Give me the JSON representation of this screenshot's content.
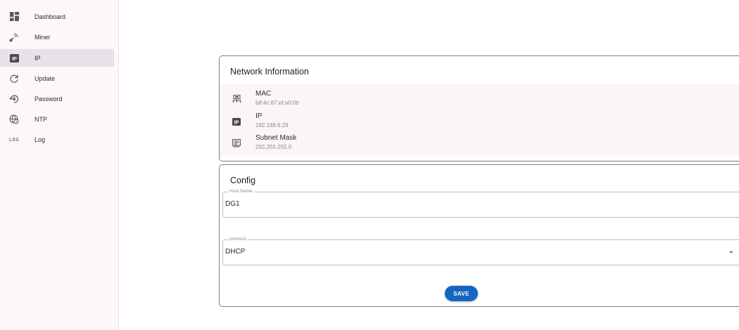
{
  "sidebar": {
    "items": [
      {
        "label": "Dashboard",
        "icon": "dashboard-icon"
      },
      {
        "label": "Miner",
        "icon": "satellite-dish-icon"
      },
      {
        "label": "IP",
        "icon": "ip-icon",
        "active": true
      },
      {
        "label": "Update",
        "icon": "refresh-icon"
      },
      {
        "label": "Password",
        "icon": "lock-reset-icon"
      },
      {
        "label": "NTP",
        "icon": "globe-clock-icon"
      },
      {
        "label": "Log",
        "icon": "log-icon",
        "icon_text": "LOG"
      }
    ]
  },
  "network": {
    "title": "Network Information",
    "rows": [
      {
        "label": "MAC",
        "value": "b8:4c:87:ef:a0:0b",
        "icon": "lan-icon"
      },
      {
        "label": "IP",
        "value": "192.168.6.29",
        "icon": "ip-icon",
        "icon_text": "IP"
      },
      {
        "label": "Subnet Mask",
        "value": "255.255.255.0",
        "icon": "subnet-icon"
      }
    ]
  },
  "config": {
    "title": "Config",
    "host_name": {
      "label": "Host Name",
      "value": "DG1"
    },
    "protocol": {
      "label": "protocol",
      "value": "DHCP"
    },
    "save_label": "SAVE"
  },
  "colors": {
    "accent": "#1565c0",
    "sidebar_bg": "#fdf7fb",
    "active_item_bg": "#e8e2e8",
    "list_bg": "#fbf5fa"
  }
}
